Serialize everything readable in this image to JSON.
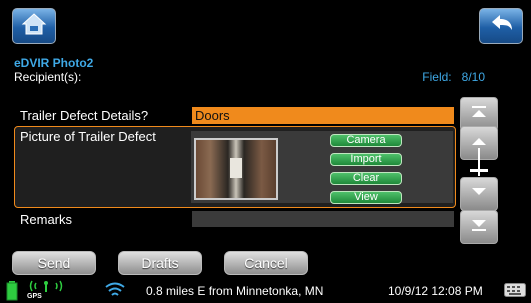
{
  "header": {
    "title": "eDVIR Photo2",
    "recipients_label": "Recipient(s):",
    "field_label": "Field:",
    "field_value": "8/10"
  },
  "form": {
    "trailer_defect_details": {
      "label": "Trailer Defect Details?",
      "value": "Doors"
    },
    "picture_of_trailer_defect": {
      "label": "Picture of Trailer Defect",
      "buttons": [
        "Camera",
        "Import",
        "Clear",
        "View"
      ]
    },
    "remarks": {
      "label": "Remarks",
      "value": ""
    }
  },
  "actions": {
    "send": "Send",
    "drafts": "Drafts",
    "cancel": "Cancel"
  },
  "status": {
    "gps_label": "GPS",
    "location": "0.8 miles E from Minnetonka, MN",
    "datetime": "10/9/12 12:08 PM"
  },
  "icons": {
    "home": "home-icon",
    "back": "back-arrow-icon",
    "battery": "battery-icon",
    "antenna": "antenna-icon",
    "wifi": "wifi-icon",
    "keyboard": "keyboard-icon"
  },
  "colors": {
    "accent_blue": "#3fa9e6",
    "highlight_orange": "#f08a1c",
    "button_green": "#2aa84a"
  }
}
